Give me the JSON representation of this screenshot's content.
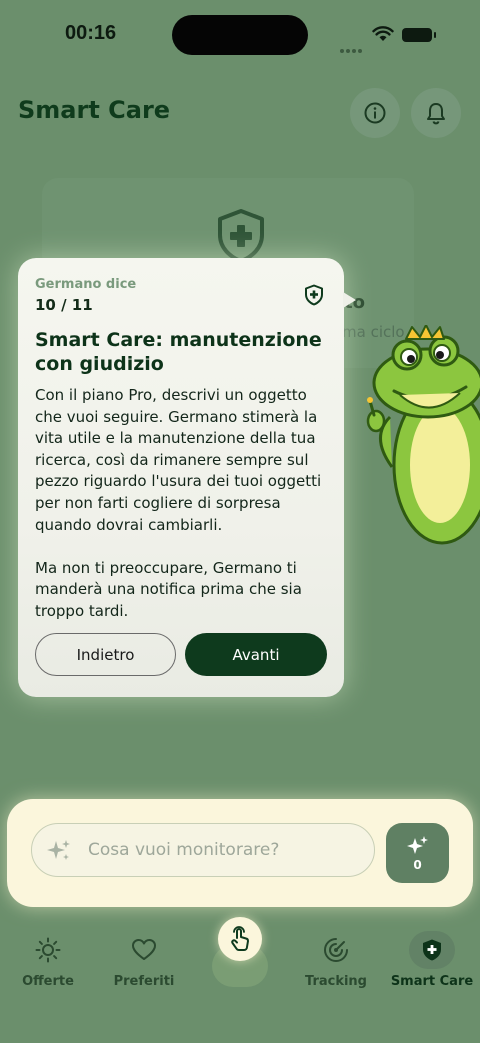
{
  "status_bar": {
    "time": "00:16"
  },
  "header": {
    "title": "Smart Care",
    "info_icon": "info-icon",
    "bell_icon": "bell-icon"
  },
  "background_card": {
    "title_fragment": "to",
    "subtitle_fragment": "ma ciclo"
  },
  "tooltip": {
    "speaker": "Germano dice",
    "counter": "10 / 11",
    "title": "Smart Care: manutenzione con giudizio",
    "body": "Con il piano Pro, descrivi un oggetto che vuoi seguire. Germano stimerà la vita utile e la manutenzione della tua ricerca, così da rimanere sempre sul pezzo riguardo l'usura dei tuoi oggetti per non farti cogliere di sorpresa quando dovrai cambiarli.\n\nMa non ti preoccupare, Germano ti manderà una notifica prima che sia troppo tardi.",
    "back_label": "Indietro",
    "next_label": "Avanti"
  },
  "composer": {
    "placeholder": "Cosa vuoi monitorare?",
    "credits": "0"
  },
  "tabbar": {
    "items": [
      {
        "label": "Offerte",
        "icon": "sun-icon"
      },
      {
        "label": "Preferiti",
        "icon": "heart-icon"
      },
      {
        "label": "Tracking",
        "icon": "radar-icon"
      },
      {
        "label": "Smart Care",
        "icon": "shield-plus-icon"
      }
    ],
    "center_icon": "tap-hand-icon"
  },
  "colors": {
    "background": "#6b8f6c",
    "primary": "#0e3a1d",
    "accent_cream": "#fbf6dc",
    "frog_green": "#8cc63f"
  }
}
